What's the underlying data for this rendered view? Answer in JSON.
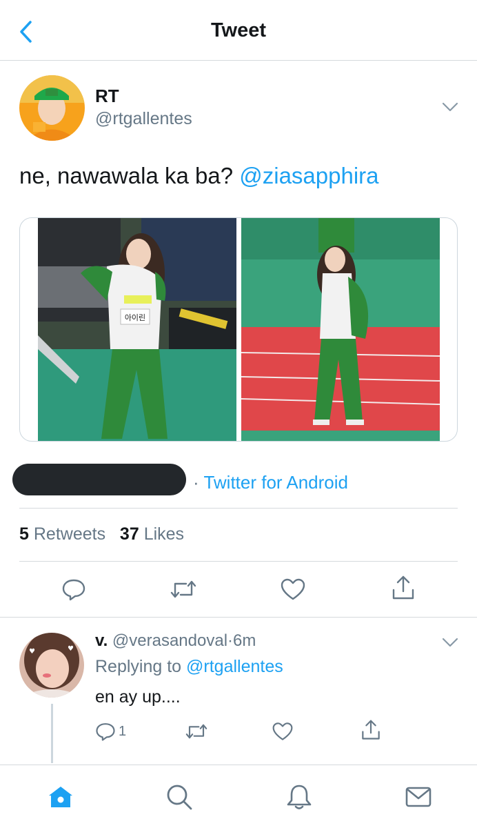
{
  "header": {
    "title": "Tweet",
    "back_icon": "chevron-left-icon"
  },
  "tweet": {
    "author_name": "RT",
    "author_handle": "@rtgallentes",
    "text": "ne, nawawala ka ba? ",
    "mention": "@ziasapphira",
    "image_labels": [
      "아이린"
    ],
    "source_separator": "·",
    "source": "Twitter for Android",
    "retweet_count": "5",
    "retweet_label": "Retweets",
    "like_count": "37",
    "like_label": "Likes"
  },
  "actions": [
    "reply-icon",
    "retweet-icon",
    "like-icon",
    "share-icon"
  ],
  "reply": {
    "name": "v.",
    "handle": "@verasandoval",
    "separator": "·",
    "time": "6m",
    "replying_prefix": "Replying to ",
    "replying_to": "@rtgallentes",
    "text": "en ay up....",
    "reply_count": "1"
  },
  "tabbar": [
    "home-icon",
    "search-icon",
    "notifications-icon",
    "messages-icon"
  ],
  "colors": {
    "accent": "#1da1f2",
    "text": "#14171a",
    "secondary": "#657786",
    "border": "#d5d9dc"
  }
}
